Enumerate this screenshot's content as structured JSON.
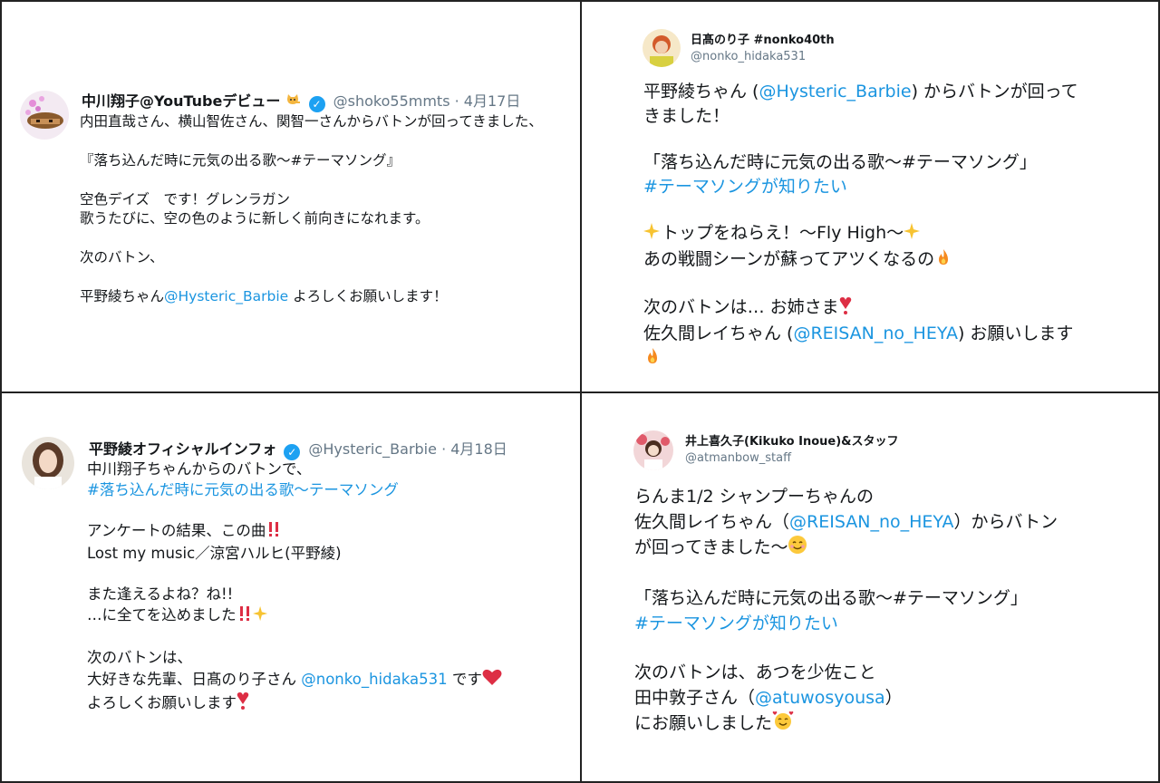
{
  "colors": {
    "link": "#1b95e0",
    "muted": "#657786",
    "verified": "#1da1f2",
    "text": "#14171a"
  },
  "tweets": [
    {
      "name": "中川翔子@YouTubeデビュー",
      "badge_icon": "cat-emoji",
      "handle": "@shoko55mmts",
      "date": "4月17日",
      "lines": [
        "内田直哉さん、横山智佐さん、関智一さんからバトンが回ってきました、",
        "『落ち込んだ時に元気の出る歌〜#テーマソング』",
        "空色デイズ　です！グレンラガン",
        "歌うたびに、空の色のように新しく前向きになれます。",
        "次のバトン、"
      ],
      "last_pre": "平野綾ちゃん",
      "last_link": "@Hysteric_Barbie",
      "last_post": " よろしくお願いします！"
    },
    {
      "name": "日髙のり子 #nonko40th",
      "handle": "@nonko_hidaka531",
      "l1_pre": "平野綾ちゃん (",
      "l1_link": "@Hysteric_Barbie",
      "l1_post": ") からバトンが回って",
      "l2": "きました！",
      "l3": "「落ち込んだ時に元気の出る歌〜#テーマソング」",
      "l4_link": "#テーマソングが知りたい",
      "l5": "トップをねらえ！〜Fly High〜",
      "l6": "あの戦闘シーンが蘇ってアツくなるの",
      "l7": "次のバトンは… お姉さま",
      "l8_pre": "佐久間レイちゃん (",
      "l8_link": "@REISAN_no_HEYA",
      "l8_post": ") お願いします"
    },
    {
      "name": "平野綾オフィシャルインフォ",
      "handle": "@Hysteric_Barbie",
      "date": "4月18日",
      "l1": "中川翔子ちゃんからのバトンで、",
      "l2_link": "#落ち込んだ時に元気の出る歌〜テーマソング",
      "l3": "アンケートの結果、この曲",
      "l4": "Lost my music／涼宮ハルヒ(平野綾)",
      "l5": "また逢えるよね？ね!!",
      "l6": "…に全てを込めました",
      "l7": "次のバトンは、",
      "l8_pre": "大好きな先輩、日髙のり子さん ",
      "l8_link": "@nonko_hidaka531",
      "l8_post": " です",
      "l9": "よろしくお願いします"
    },
    {
      "name": "井上喜久子(Kikuko Inoue)&スタッフ",
      "handle": "@atmanbow_staff",
      "l1": "らんま1/2  シャンプーちゃんの",
      "l2_pre": "佐久間レイちゃん（",
      "l2_link": "@REISAN_no_HEYA",
      "l2_post": "）からバトン",
      "l3": "が回ってきました〜",
      "l4": "「落ち込んだ時に元気の出る歌〜#テーマソング」",
      "l5_link": "#テーマソングが知りたい",
      "l6": "次のバトンは、あつを少佐こと",
      "l7_pre": "田中敦子さん（",
      "l7_link": "@atuwosyousa",
      "l7_post": "）",
      "l8": "にお願いしました"
    }
  ]
}
